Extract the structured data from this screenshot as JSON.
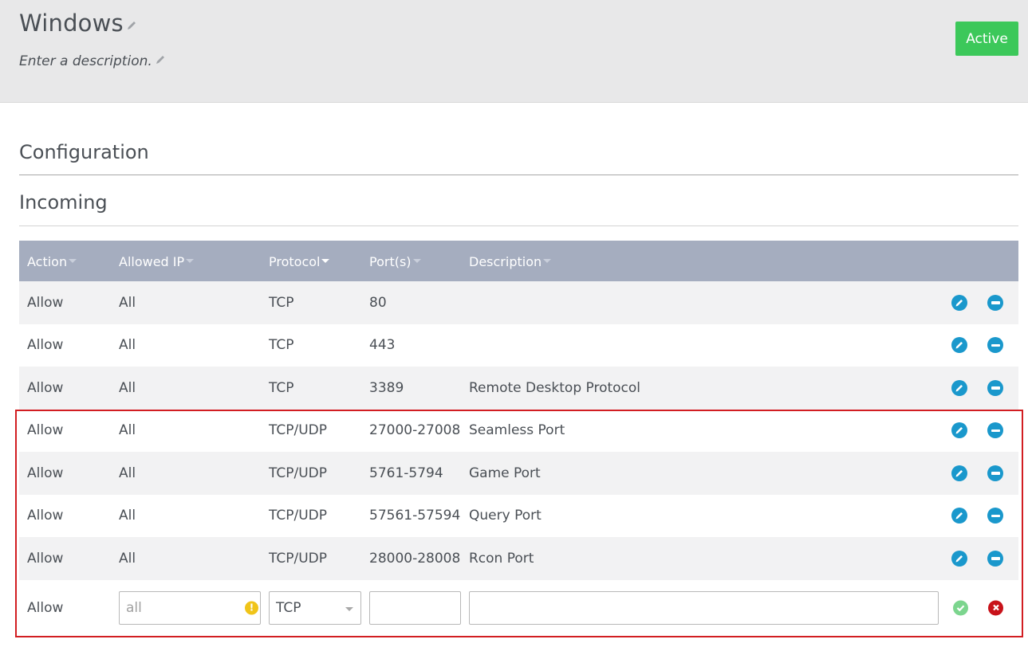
{
  "header": {
    "title": "Windows",
    "description_placeholder": "Enter a description.",
    "status_label": "Active",
    "status_color": "#3cc85a"
  },
  "sections": {
    "configuration": "Configuration",
    "incoming": "Incoming"
  },
  "table": {
    "columns": [
      {
        "label": "Action",
        "sortable": true
      },
      {
        "label": "Allowed IP",
        "sortable": true
      },
      {
        "label": "Protocol",
        "sortable": true,
        "active": true
      },
      {
        "label": "Port(s)",
        "sortable": true
      },
      {
        "label": "Description",
        "sortable": true
      }
    ],
    "rows": [
      {
        "action": "Allow",
        "ip": "All",
        "protocol": "TCP",
        "ports": "80",
        "description": ""
      },
      {
        "action": "Allow",
        "ip": "All",
        "protocol": "TCP",
        "ports": "443",
        "description": ""
      },
      {
        "action": "Allow",
        "ip": "All",
        "protocol": "TCP",
        "ports": "3389",
        "description": "Remote Desktop Protocol"
      },
      {
        "action": "Allow",
        "ip": "All",
        "protocol": "TCP/UDP",
        "ports": "27000-27008",
        "description": "Seamless Port"
      },
      {
        "action": "Allow",
        "ip": "All",
        "protocol": "TCP/UDP",
        "ports": "5761-5794",
        "description": "Game Port"
      },
      {
        "action": "Allow",
        "ip": "All",
        "protocol": "TCP/UDP",
        "ports": "57561-57594",
        "description": "Query Port"
      },
      {
        "action": "Allow",
        "ip": "All",
        "protocol": "TCP/UDP",
        "ports": "28000-28008",
        "description": "Rcon Port"
      }
    ],
    "new_row": {
      "action": "Allow",
      "ip_value": "all",
      "ip_warning": "!",
      "protocol_selected": "TCP",
      "ports_value": "",
      "description_value": ""
    },
    "icons": {
      "edit": "pencil-icon",
      "remove": "minus-circle-icon",
      "confirm": "check-circle-icon",
      "cancel": "x-circle-icon"
    },
    "accent_color": "#1a98cc",
    "highlight_color": "#d21e22"
  }
}
